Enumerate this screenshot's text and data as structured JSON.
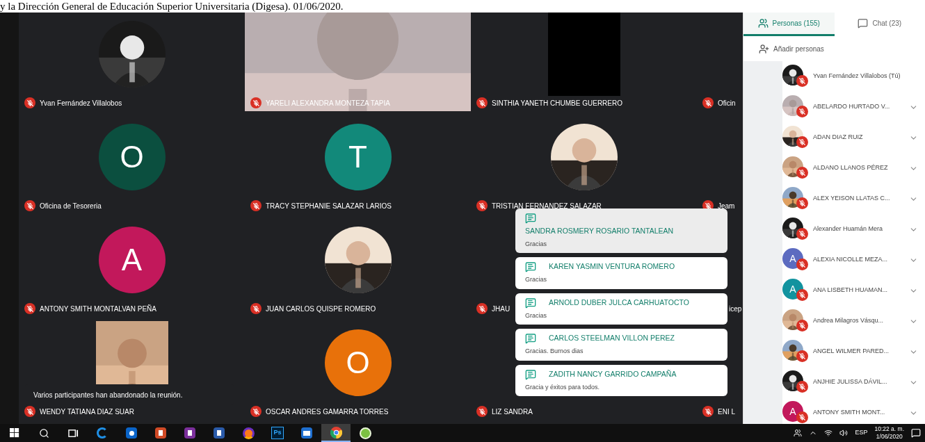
{
  "caption": "y la Dirección General de Educación Superior Universitaria (Digesa). 01/06/2020.",
  "grid": {
    "rows": [
      [
        {
          "name": "Yvan Fernández Villalobos",
          "kind": "circle_photo",
          "muted": true
        },
        {
          "name": "YARELI ALEXANDRA MONTEZA TAPIA",
          "kind": "video",
          "muted": true
        },
        {
          "name": "SINTHIA YANETH CHUMBE GUERRERO",
          "kind": "dark_video",
          "muted": true
        },
        {
          "name": "Oficin",
          "kind": "empty",
          "muted": true
        }
      ],
      [
        {
          "name": "Oficina de Tesoreria",
          "kind": "letter",
          "letter": "O",
          "color": "#0b4f3f",
          "muted": true
        },
        {
          "name": "TRACY STEPHANIE SALAZAR LARIOS",
          "kind": "letter",
          "letter": "T",
          "color": "#12897a",
          "muted": true
        },
        {
          "name": "TRISTIAN FERNANDEZ SALAZAR",
          "kind": "circle_photo",
          "muted": true
        },
        {
          "name": "Jeam",
          "kind": "empty",
          "muted": true
        }
      ],
      [
        {
          "name": "ANTONY SMITH MONTALVAN PEÑA",
          "kind": "letter",
          "letter": "A",
          "color": "#c2185b",
          "muted": true
        },
        {
          "name": "JUAN CARLOS QUISPE ROMERO",
          "kind": "circle_photo",
          "muted": true
        },
        {
          "name": "JHAU",
          "kind": "empty",
          "muted": true
        },
        {
          "name": "icep",
          "kind": "empty",
          "muted": false
        }
      ],
      [
        {
          "name": "WENDY TATIANA DIAZ SUAR",
          "kind": "square_photo",
          "muted": true
        },
        {
          "name": "OSCAR ANDRES GAMARRA TORRES",
          "kind": "letter",
          "letter": "O",
          "color": "#e8710a",
          "muted": true
        },
        {
          "name": "LIZ SANDRA",
          "kind": "empty",
          "muted": true
        },
        {
          "name": "ENI L",
          "kind": "empty",
          "muted": true
        }
      ]
    ],
    "left_notice": "Varios participantes han abandonado la reunión.",
    "chat_toasts": [
      {
        "name": "SANDRA ROSMERY ROSARIO TANTALEAN",
        "message": "Gracias",
        "highlighted": true
      },
      {
        "name": "KAREN YASMIN VENTURA ROMERO",
        "message": "Gracias",
        "highlighted": false
      },
      {
        "name": "ARNOLD DUBER JULCA CARHUATOCTO",
        "message": "Gracias",
        "highlighted": false
      },
      {
        "name": "CARLOS STEELMAN VILLON PEREZ",
        "message": "Gracias. Burnos dias",
        "highlighted": false
      },
      {
        "name": "ZADITH NANCY GARRIDO CAMPAÑA",
        "message": "Gracia y éxitos para todos.",
        "highlighted": false
      }
    ]
  },
  "sidebar": {
    "tabs": [
      {
        "label": "Personas (155)",
        "kind": "people",
        "selected": true
      },
      {
        "label": "Chat (23)",
        "kind": "chat",
        "selected": false
      }
    ],
    "add_people": "Añadir personas",
    "people": [
      {
        "name": "Yvan Fernández Villalobos (Tú)",
        "has_menu": false
      },
      {
        "name": "ABELARDO HURTADO V...",
        "has_menu": true
      },
      {
        "name": "ADAN DIAZ RUIZ",
        "has_menu": true
      },
      {
        "name": "ALDANO LLANOS PÉREZ",
        "has_menu": true
      },
      {
        "name": "ALEX YEISON LLATAS C...",
        "has_menu": true
      },
      {
        "name": "Alexander Huamán Mera",
        "has_menu": true
      },
      {
        "name": "ALEXIA NICOLLE MEZA...",
        "kind": "letter",
        "letter": "A",
        "color": "#5c6bc0",
        "has_menu": true
      },
      {
        "name": "ANA LISBETH HUAMAN...",
        "kind": "letter",
        "letter": "A",
        "color": "#12939f",
        "has_menu": true
      },
      {
        "name": "Andrea Milagros Vásqu...",
        "has_menu": true
      },
      {
        "name": "ANGEL WILMER PARED...",
        "has_menu": true
      },
      {
        "name": "ANJHIE JULISSA DÁVIL...",
        "has_menu": true
      },
      {
        "name": "ANTONY SMITH MONT...",
        "kind": "letter",
        "letter": "A",
        "color": "#c2185b",
        "has_menu": true
      }
    ]
  },
  "taskbar": {
    "apps": [
      {
        "kind": "start",
        "selected": false
      },
      {
        "kind": "search",
        "selected": false
      },
      {
        "kind": "taskview",
        "selected": false
      },
      {
        "kind": "edge",
        "selected": false
      },
      {
        "kind": "outlook",
        "selected": false
      },
      {
        "kind": "powerpoint",
        "selected": false
      },
      {
        "kind": "onenote",
        "selected": false
      },
      {
        "kind": "word",
        "selected": false
      },
      {
        "kind": "firefox",
        "selected": false
      },
      {
        "kind": "photoshop",
        "label": "Ps",
        "selected": false
      },
      {
        "kind": "window",
        "selected": false
      },
      {
        "kind": "chrome",
        "selected": true
      },
      {
        "kind": "ball",
        "selected": false
      }
    ],
    "language": "ESP",
    "time": "10:22 a. m.",
    "date": "1/06/2020"
  }
}
